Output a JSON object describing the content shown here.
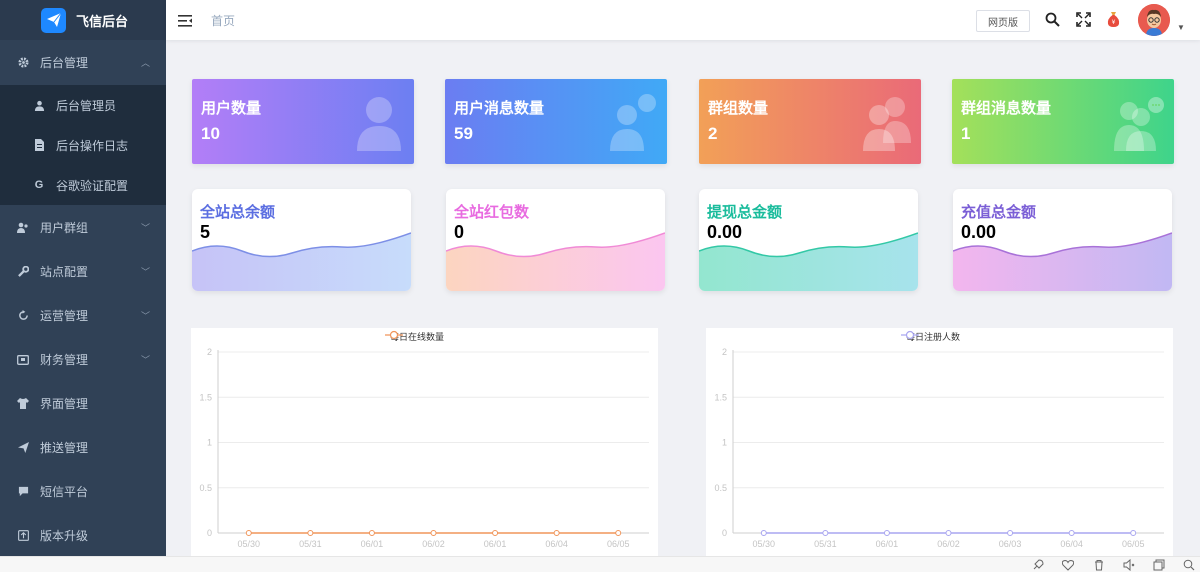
{
  "app": {
    "title": "飞信后台"
  },
  "sidebar": {
    "items": [
      {
        "label": "后台管理",
        "icon": "gear-icon",
        "open": true,
        "children": [
          {
            "label": "后台管理员",
            "icon": "user-icon"
          },
          {
            "label": "后台操作日志",
            "icon": "document-icon"
          },
          {
            "label": "谷歌验证配置",
            "icon": "google-icon"
          }
        ]
      },
      {
        "label": "用户群组",
        "icon": "users-icon"
      },
      {
        "label": "站点配置",
        "icon": "wrench-icon"
      },
      {
        "label": "运营管理",
        "icon": "refresh-icon"
      },
      {
        "label": "财务管理",
        "icon": "wallet-icon"
      },
      {
        "label": "界面管理",
        "icon": "shirt-icon"
      },
      {
        "label": "推送管理",
        "icon": "send-icon"
      },
      {
        "label": "短信平台",
        "icon": "chat-icon"
      },
      {
        "label": "版本升级",
        "icon": "upgrade-icon"
      }
    ]
  },
  "topbar": {
    "breadcrumb": "首页",
    "web_button": "网页版"
  },
  "stats": [
    {
      "label": "用户数量",
      "value": "10"
    },
    {
      "label": "用户消息数量",
      "value": "59"
    },
    {
      "label": "群组数量",
      "value": "2"
    },
    {
      "label": "群组消息数量",
      "value": "1"
    }
  ],
  "finance": [
    {
      "label": "全站总余额",
      "value": "5",
      "color": "#5b6ee1"
    },
    {
      "label": "全站红包数",
      "value": "0",
      "color": "#e86be0"
    },
    {
      "label": "提现总金额",
      "value": "0.00",
      "color": "#1abc9c"
    },
    {
      "label": "充值总金额",
      "value": "0.00",
      "color": "#7b5fd6"
    }
  ],
  "chart_data": [
    {
      "type": "line",
      "title": "",
      "series": [
        {
          "name": "每日在线数量",
          "values": [
            0,
            0,
            0,
            0,
            0,
            0,
            0
          ]
        }
      ],
      "categories": [
        "05/30",
        "05/31",
        "06/01",
        "06/02",
        "06/01",
        "06/04",
        "06/05"
      ],
      "yticks": [
        "0",
        "0.5",
        "1",
        "1.5",
        "2"
      ],
      "ylim": [
        0,
        2
      ],
      "grid": true,
      "legend": "top-center",
      "color": "#f0955a"
    },
    {
      "type": "line",
      "title": "",
      "series": [
        {
          "name": "每日注册人数",
          "values": [
            0,
            0,
            0,
            0,
            0,
            0,
            0
          ]
        }
      ],
      "categories": [
        "05/30",
        "05/31",
        "06/01",
        "06/02",
        "06/03",
        "06/04",
        "06/05"
      ],
      "yticks": [
        "0",
        "0.5",
        "1",
        "1.5",
        "2"
      ],
      "ylim": [
        0,
        2
      ],
      "grid": true,
      "legend": "top-center",
      "color": "#a9a6f0"
    }
  ]
}
